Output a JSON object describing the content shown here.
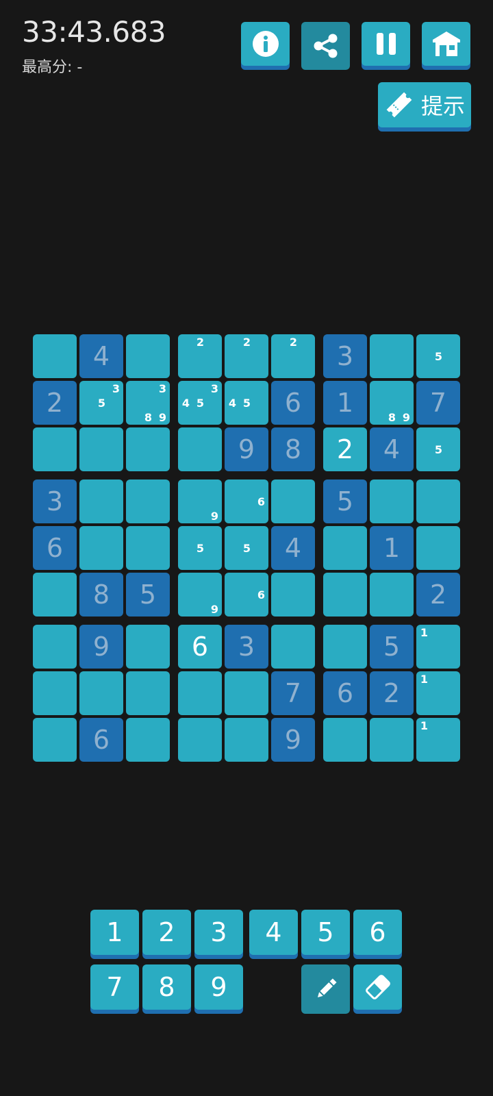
{
  "header": {
    "timer": "33:43.683",
    "best_score_label": "最高分: -",
    "buttons": [
      {
        "name": "info-button",
        "icon": "info-icon"
      },
      {
        "name": "share-button",
        "icon": "share-icon"
      },
      {
        "name": "pause-button",
        "icon": "pause-icon"
      },
      {
        "name": "home-button",
        "icon": "home-icon"
      }
    ],
    "hint_label": "提示"
  },
  "board": {
    "rows": [
      [
        {
          "v": ""
        },
        {
          "v": "4",
          "g": true
        },
        {
          "v": ""
        },
        {
          "n": [
            2
          ]
        },
        {
          "n": [
            2
          ]
        },
        {
          "n": [
            2
          ]
        },
        {
          "v": "3",
          "g": true
        },
        {
          "v": ""
        },
        {
          "n": [
            5
          ]
        }
      ],
      [
        {
          "v": "2",
          "g": true
        },
        {
          "n": [
            3,
            5
          ]
        },
        {
          "n": [
            3,
            8,
            9
          ]
        },
        {
          "n": [
            3,
            4,
            5
          ]
        },
        {
          "n": [
            4,
            5
          ]
        },
        {
          "v": "6",
          "g": true
        },
        {
          "v": "1",
          "g": true
        },
        {
          "n": [
            8,
            9
          ]
        },
        {
          "v": "7",
          "g": true
        }
      ],
      [
        {
          "v": ""
        },
        {
          "v": ""
        },
        {
          "v": ""
        },
        {
          "v": ""
        },
        {
          "v": "9",
          "g": true
        },
        {
          "v": "8",
          "g": true
        },
        {
          "v": "2",
          "u": true
        },
        {
          "v": "4",
          "g": true
        },
        {
          "n": [
            5
          ]
        }
      ],
      [
        {
          "v": "3",
          "g": true
        },
        {
          "v": ""
        },
        {
          "v": ""
        },
        {
          "n": [
            9
          ]
        },
        {
          "n": [
            6
          ]
        },
        {
          "v": ""
        },
        {
          "v": "5",
          "g": true
        },
        {
          "v": ""
        },
        {
          "v": ""
        }
      ],
      [
        {
          "v": "6",
          "g": true
        },
        {
          "v": ""
        },
        {
          "v": ""
        },
        {
          "n": [
            5
          ]
        },
        {
          "n": [
            5
          ]
        },
        {
          "v": "4",
          "g": true
        },
        {
          "v": ""
        },
        {
          "v": "1",
          "g": true
        },
        {
          "v": ""
        }
      ],
      [
        {
          "v": ""
        },
        {
          "v": "8",
          "g": true
        },
        {
          "v": "5",
          "g": true
        },
        {
          "n": [
            9
          ]
        },
        {
          "n": [
            6
          ]
        },
        {
          "v": ""
        },
        {
          "v": ""
        },
        {
          "v": ""
        },
        {
          "v": "2",
          "g": true
        }
      ],
      [
        {
          "v": ""
        },
        {
          "v": "9",
          "g": true
        },
        {
          "v": ""
        },
        {
          "v": "6",
          "u": true
        },
        {
          "v": "3",
          "g": true
        },
        {
          "v": ""
        },
        {
          "v": ""
        },
        {
          "v": "5",
          "g": true
        },
        {
          "n": [
            1
          ]
        }
      ],
      [
        {
          "v": ""
        },
        {
          "v": ""
        },
        {
          "v": ""
        },
        {
          "v": ""
        },
        {
          "v": ""
        },
        {
          "v": "7",
          "g": true
        },
        {
          "v": "6",
          "g": true
        },
        {
          "v": "2",
          "g": true
        },
        {
          "n": [
            1
          ]
        }
      ],
      [
        {
          "v": ""
        },
        {
          "v": "6",
          "g": true
        },
        {
          "v": ""
        },
        {
          "v": ""
        },
        {
          "v": ""
        },
        {
          "v": "9",
          "g": true
        },
        {
          "v": ""
        },
        {
          "v": ""
        },
        {
          "n": [
            1
          ]
        }
      ]
    ]
  },
  "keypad": {
    "digits": [
      "1",
      "2",
      "3",
      "4",
      "5",
      "6",
      "7",
      "8",
      "9"
    ],
    "tools": [
      {
        "name": "pencil-button",
        "icon": "pencil-icon"
      },
      {
        "name": "eraser-button",
        "icon": "eraser-icon"
      }
    ]
  },
  "colors": {
    "background": "#171717",
    "cell": "#2aacc2",
    "given_cell": "#1f6fb0",
    "given_digit": "#8fb1cf",
    "button_shadow": "#1f6fb0"
  }
}
